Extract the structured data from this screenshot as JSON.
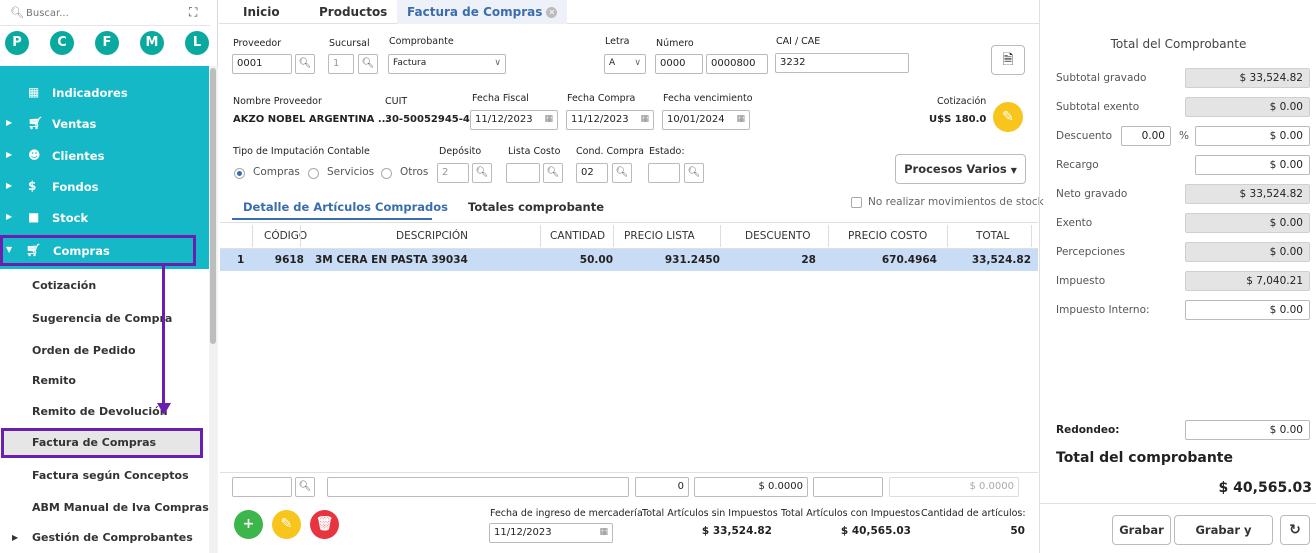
{
  "sidebar": {
    "search_placeholder": "Buscar...",
    "letters": [
      "P",
      "C",
      "F",
      "M",
      "L"
    ],
    "main_items": [
      {
        "label": "Indicadores",
        "icon": "grid-icon"
      },
      {
        "label": "Ventas",
        "icon": "cart-icon"
      },
      {
        "label": "Clientes",
        "icon": "users-icon"
      },
      {
        "label": "Fondos",
        "icon": "dollar-icon"
      },
      {
        "label": "Stock",
        "icon": "box-icon"
      }
    ],
    "compras_label": "Compras",
    "sub_items": [
      {
        "label": "Cotización"
      },
      {
        "label": "Sugerencia de Compra"
      },
      {
        "label": "Orden de Pedido"
      },
      {
        "label": "Remito"
      },
      {
        "label": "Remito de Devolución"
      },
      {
        "label": "Factura de Compras"
      },
      {
        "label": "Factura según Conceptos"
      },
      {
        "label": "ABM Manual de Iva Compras"
      },
      {
        "label": "Gestión de Comprobantes"
      }
    ]
  },
  "tabs": [
    "Inicio",
    "Productos",
    "Factura de Compras"
  ],
  "form": {
    "proveedor_label": "Proveedor",
    "proveedor": "0001",
    "sucursal_label": "Sucursal",
    "sucursal": "1",
    "comprobante_label": "Comprobante",
    "comprobante": "Factura",
    "letra_label": "Letra",
    "letra": "A",
    "numero_label": "Número",
    "numero_pv": "0000",
    "numero": "0000800",
    "cai_label": "CAI / CAE",
    "cai": "3232",
    "nombre_label": "Nombre Proveedor",
    "nombre": "AKZO NOBEL ARGENTINA ...",
    "cuit_label": "CUIT",
    "cuit": "30-50052945-4",
    "fecha_fiscal_label": "Fecha Fiscal",
    "fecha_fiscal": "11/12/2023",
    "fecha_compra_label": "Fecha Compra",
    "fecha_compra": "11/12/2023",
    "fecha_venc_label": "Fecha vencimiento",
    "fecha_venc": "10/01/2024",
    "cotizacion_label": "Cotización",
    "cotizacion": "U$S 180.0",
    "tipo_label": "Tipo de Imputación Contable",
    "radio_compras": "Compras",
    "radio_servicios": "Servicios",
    "radio_otros": "Otros",
    "deposito_label": "Depósito",
    "deposito": "2",
    "lista_label": "Lista Costo",
    "cond_label": "Cond. Compra",
    "cond": "02",
    "estado_label": "Estado:",
    "procesos": "Procesos Varios",
    "no_mov": "No realizar movimientos de stock"
  },
  "subtabs": [
    "Detalle de Artículos Comprados",
    "Totales comprobante"
  ],
  "grid": {
    "headers": [
      "CÓDIGO",
      "DESCRIPCIÓN",
      "CANTIDAD",
      "PRECIO LISTA",
      "DESCUENTO",
      "PRECIO COSTO",
      "TOTAL"
    ],
    "rows": [
      {
        "n": "1",
        "codigo": "9618",
        "descripcion": "3M CERA EN PASTA 39034",
        "cantidad": "50.00",
        "precio_lista": "931.2450",
        "descuento": "28",
        "precio_costo": "670.4964",
        "total": "33,524.82"
      }
    ]
  },
  "bottom": {
    "qty": "0",
    "price": "$ 0.0000",
    "total_readonly": "$ 0.0000",
    "fecha_ingreso_label": "Fecha de ingreso de mercadería",
    "fecha_ingreso": "11/12/2023",
    "sin_imp_label": "Total Artículos sin Impuestos",
    "sin_imp": "$ 33,524.82",
    "con_imp_label": "Total Artículos con Impuestos",
    "con_imp": "$ 40,565.03",
    "cant_label": "Cantidad de artículos:",
    "cant": "50"
  },
  "totals": {
    "title": "Total del Comprobante",
    "rows": [
      {
        "label": "Subtotal gravado",
        "value": "$ 33,524.82"
      },
      {
        "label": "Subtotal exento",
        "value": "$ 0.00"
      },
      {
        "label": "Descuento",
        "pct": "0.00",
        "value": "$ 0.00"
      },
      {
        "label": "Recargo",
        "value": "$ 0.00"
      },
      {
        "label": "Neto gravado",
        "value": "$ 33,524.82"
      },
      {
        "label": "Exento",
        "value": "$ 0.00"
      },
      {
        "label": "Percepciones",
        "value": "$ 0.00"
      },
      {
        "label": "Impuesto",
        "value": "$ 7,040.21"
      },
      {
        "label": "Impuesto Interno:",
        "value": "$ 0.00"
      }
    ],
    "pct_sign": "%",
    "redondeo_label": "Redondeo:",
    "redondeo": "$ 0.00",
    "total_label": "Total del comprobante",
    "total": "$ 40,565.03",
    "grabar": "Grabar",
    "grabar_pagar": "Grabar y Pagar"
  },
  "colors": {
    "teal": "#15b8c6",
    "purple": "#6a1fb0",
    "accent_blue": "#3a6db0",
    "yellow": "#f7c51c",
    "green": "#3cb54a",
    "red": "#e8343f"
  }
}
